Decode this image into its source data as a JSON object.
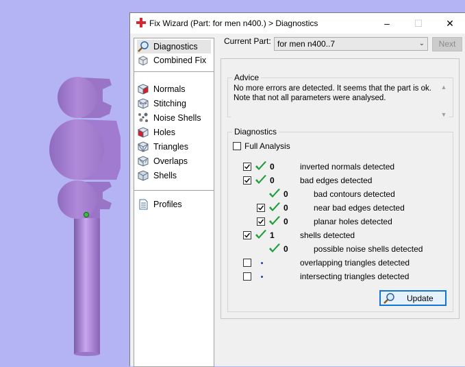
{
  "window": {
    "title": "Fix Wizard (Part: for men n400.) > Diagnostics",
    "min": "–",
    "max": "☐",
    "close": "✕"
  },
  "nav": {
    "items": [
      {
        "label": "Diagnostics",
        "icon": "magnifier-icon",
        "selected": true
      },
      {
        "label": "Combined Fix",
        "icon": "combined-fix-icon"
      },
      {
        "label": "Normals",
        "icon": "normals-cube-icon"
      },
      {
        "label": "Stitching",
        "icon": "stitching-cube-icon"
      },
      {
        "label": "Noise Shells",
        "icon": "noise-shells-icon"
      },
      {
        "label": "Holes",
        "icon": "holes-cube-icon"
      },
      {
        "label": "Triangles",
        "icon": "triangles-cube-icon"
      },
      {
        "label": "Overlaps",
        "icon": "overlaps-cube-icon"
      },
      {
        "label": "Shells",
        "icon": "shells-cube-icon"
      },
      {
        "label": "Profiles",
        "icon": "profiles-doc-icon"
      }
    ]
  },
  "current_part": {
    "label": "Current Part:",
    "value": "for men n400..7",
    "next_label": "Next"
  },
  "advice": {
    "title": "Advice",
    "text": "No more errors are detected. It seems that the part is ok. Note that not all parameters were analysed."
  },
  "diagnostics": {
    "title": "Diagnostics",
    "full_analysis_label": "Full Analysis",
    "full_analysis_checked": false,
    "rows": [
      {
        "checkbox": true,
        "checked": true,
        "status": "ok",
        "count": "0",
        "label": "inverted normals detected",
        "indent": 0
      },
      {
        "checkbox": true,
        "checked": true,
        "status": "ok",
        "count": "0",
        "label": "bad edges detected",
        "indent": 0
      },
      {
        "checkbox": false,
        "checked": false,
        "status": "ok",
        "count": "0",
        "label": "bad contours detected",
        "indent": 1
      },
      {
        "checkbox": true,
        "checked": true,
        "status": "ok",
        "count": "0",
        "label": "near bad edges detected",
        "indent": 1
      },
      {
        "checkbox": true,
        "checked": true,
        "status": "ok",
        "count": "0",
        "label": "planar holes detected",
        "indent": 1
      },
      {
        "checkbox": true,
        "checked": true,
        "status": "ok",
        "count": "1",
        "label": "shells detected",
        "indent": 0
      },
      {
        "checkbox": false,
        "checked": false,
        "status": "ok",
        "count": "0",
        "label": "possible noise shells detected",
        "indent": 1
      },
      {
        "checkbox": true,
        "checked": false,
        "status": "none",
        "count": "",
        "label": "overlapping triangles detected",
        "indent": 0
      },
      {
        "checkbox": true,
        "checked": false,
        "status": "none",
        "count": "",
        "label": "intersecting triangles detected",
        "indent": 0
      }
    ],
    "update_label": "Update"
  },
  "colors": {
    "viewport_bg": "#b4b3f3",
    "model_purple": "#a97fd3",
    "check_green": "#1f9d3a",
    "accent_blue": "#1473d4"
  }
}
